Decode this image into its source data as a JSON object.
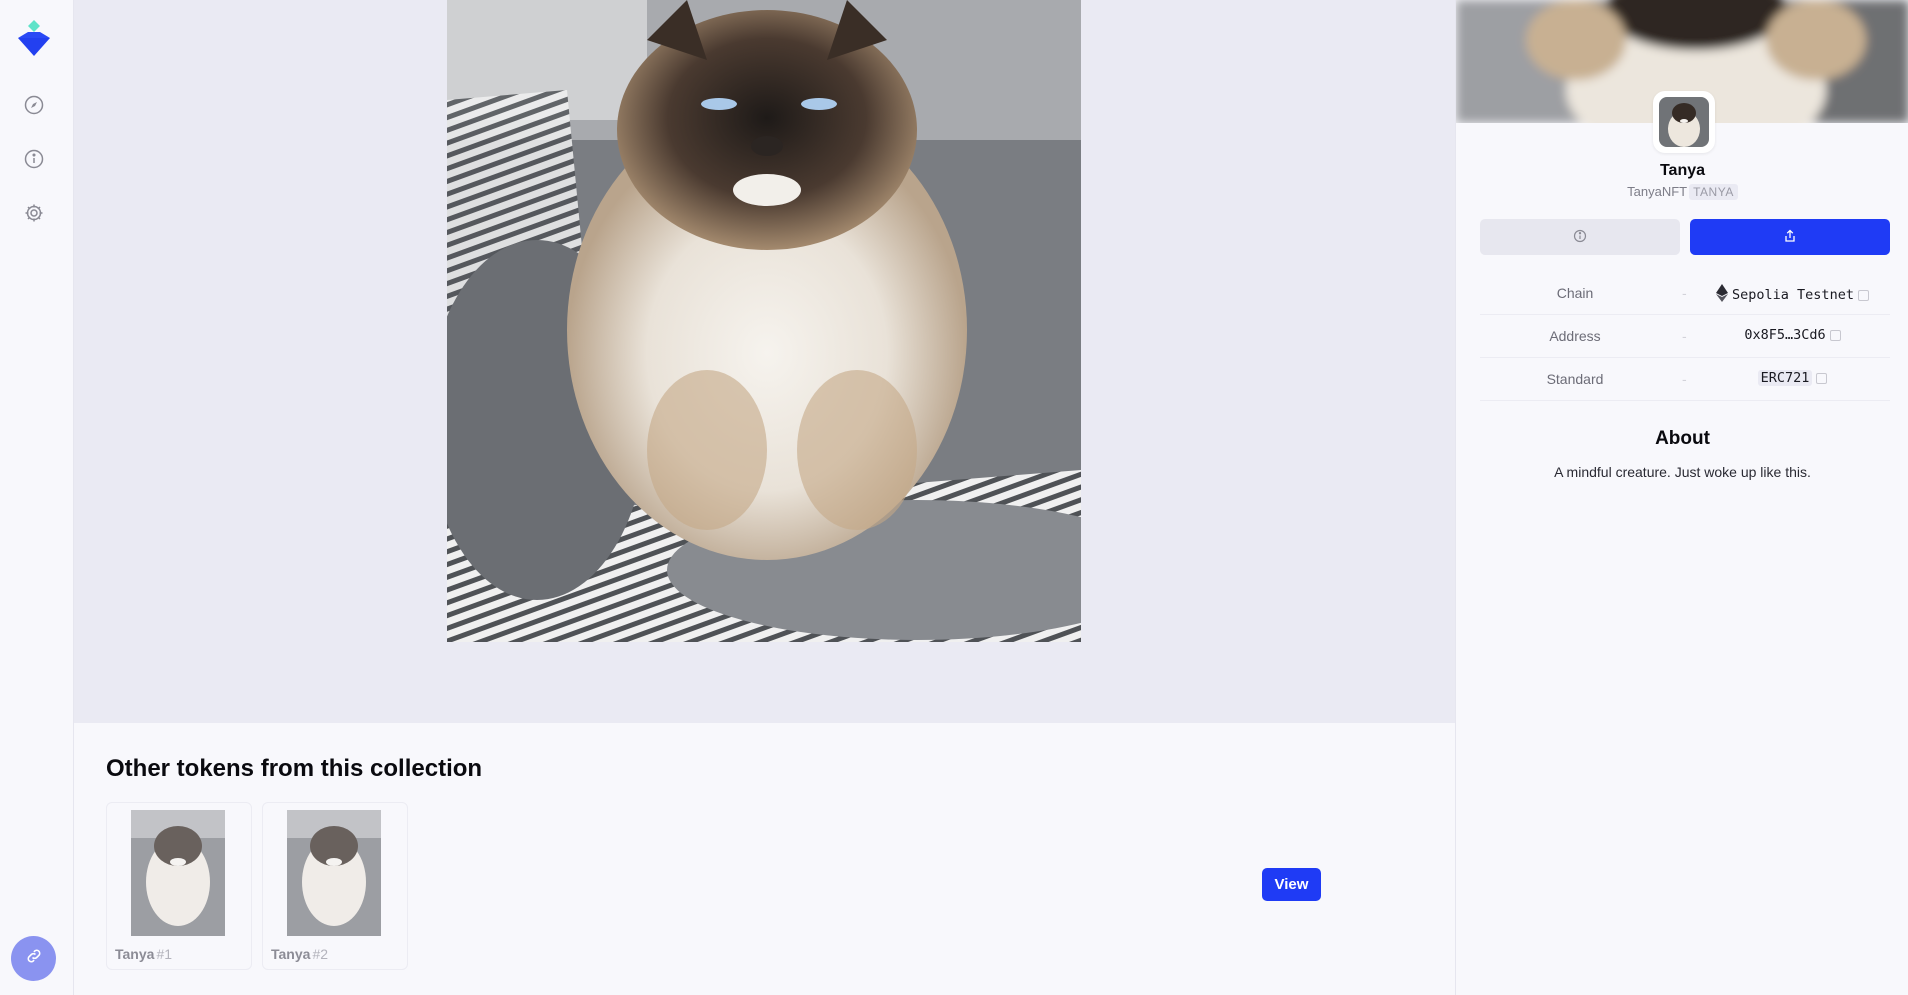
{
  "colors": {
    "accent": "#1f3bf5",
    "logo_top": "#5ee3c9",
    "logo_bottom": "#2340f0",
    "link_button": "#8a93f0"
  },
  "rail": {
    "icons": [
      "compass-icon",
      "info-icon",
      "settings-icon"
    ],
    "bottom_icon": "link-icon"
  },
  "collection": {
    "heading": "Other tokens from this collection",
    "tokens": [
      {
        "name": "Tanya",
        "id": "#1"
      },
      {
        "name": "Tanya",
        "id": "#2"
      }
    ],
    "view_label": "View"
  },
  "panel": {
    "title": "Tanya",
    "collection_name": "TanyaNFT",
    "symbol": "TANYA",
    "buttons": {
      "info_icon": "info-icon",
      "share_icon": "share-icon"
    },
    "properties": [
      {
        "key": "Chain",
        "value": "Sepolia Testnet",
        "icon": "ethereum-icon"
      },
      {
        "key": "Address",
        "value": "0x8F5…3Cd6"
      },
      {
        "key": "Standard",
        "value": "ERC721"
      }
    ],
    "about_heading": "About",
    "about_text": "A mindful creature. Just woke up like this."
  }
}
